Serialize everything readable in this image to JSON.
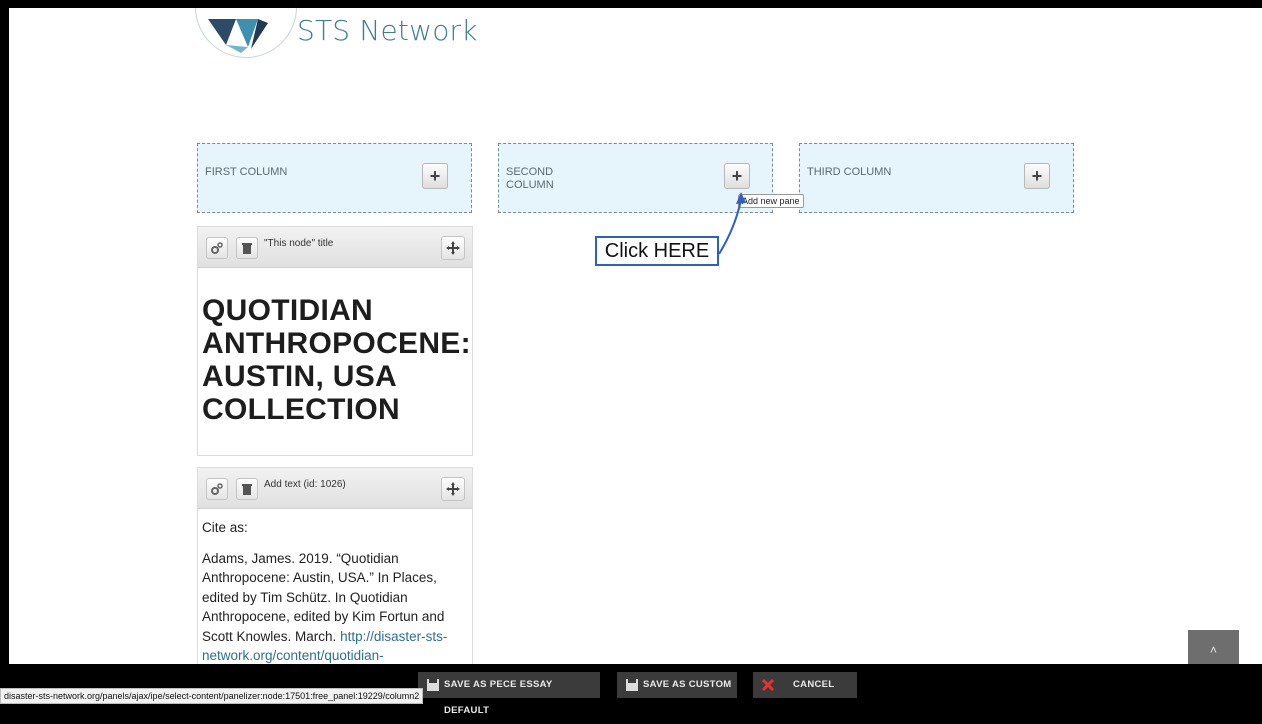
{
  "site": {
    "name": "STS Network"
  },
  "regions": [
    {
      "label": "FIRST COLUMN"
    },
    {
      "label": "SECOND COLUMN"
    },
    {
      "label": "THIRD COLUMN"
    }
  ],
  "tooltip": "Add new pane",
  "callout": "Click HERE",
  "panes": [
    {
      "title": "\"This node\" title",
      "heading": "QUOTIDIAN ANTHROPOCENE: AUSTIN, USA COLLECTION"
    },
    {
      "title": "Add text (id: 1026)",
      "cite_label": "Cite as:",
      "citation": "Adams, James. 2019. “Quotidian Anthropocene: Austin, USA.” In Places, edited by Tim Schütz. In Quotidian Anthropocene, edited by Kim Fortun and Scott Knowles. March.",
      "link": "http://disaster-sts-network.org/content/quotidian-"
    }
  ],
  "toolbar": {
    "save_default": "SAVE AS PECE ESSAY DEFAULT",
    "save_custom": "SAVE AS CUSTOM",
    "cancel": "CANCEL"
  },
  "status_url": "disaster-sts-network.org/panels/ajax/ipe/select-content/panelizer:node:17501:free_panel:19229/column2",
  "scroll_top": "˄"
}
